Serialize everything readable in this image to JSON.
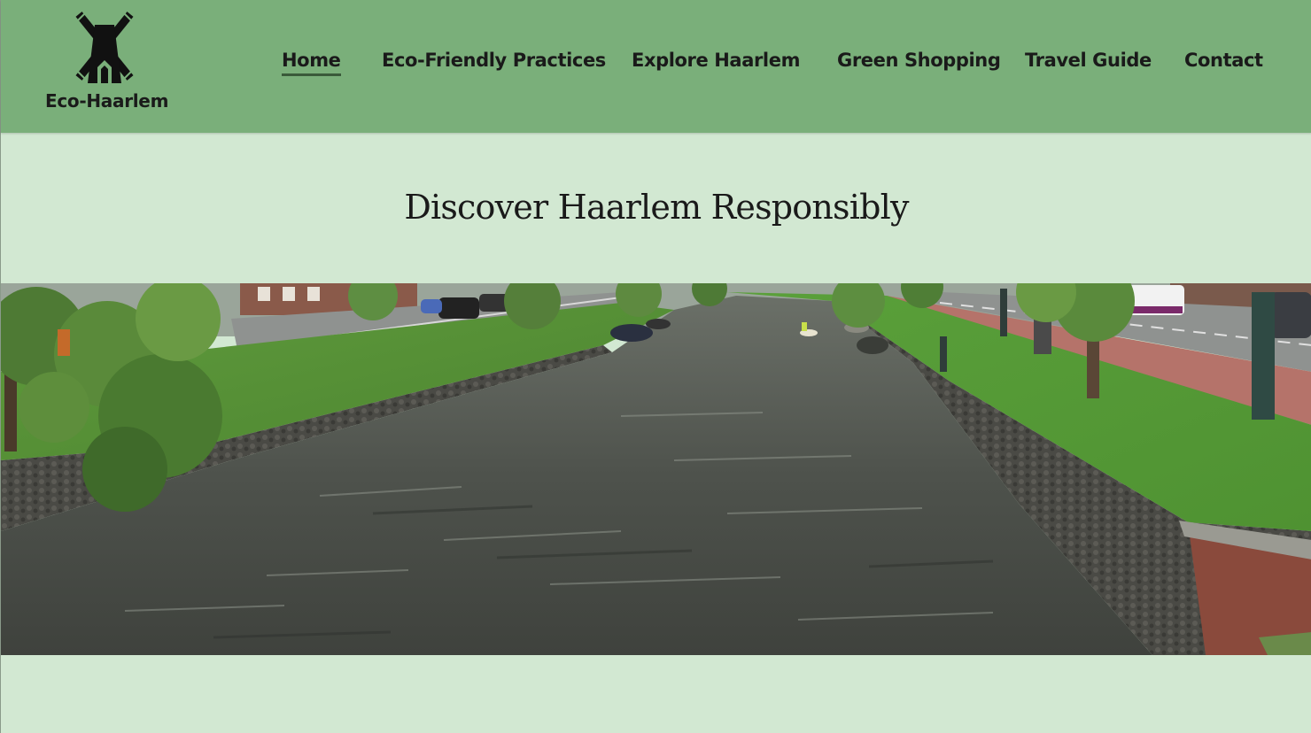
{
  "brand": {
    "name": "Eco-Haarlem",
    "logo_icon": "windmill-icon"
  },
  "nav": {
    "items": [
      {
        "label": "Home",
        "active": true
      },
      {
        "label": "Eco-Friendly Practices",
        "active": false
      },
      {
        "label": "Explore Haarlem",
        "active": false
      },
      {
        "label": "Green Shopping",
        "active": false
      },
      {
        "label": "Travel Guide",
        "active": false
      },
      {
        "label": "Contact",
        "active": false
      }
    ]
  },
  "hero": {
    "title": "Discover Haarlem Responsibly"
  },
  "colors": {
    "header_bg": "#7aaf7a",
    "page_bg": "#d2e8d2",
    "text": "#1a1a1a"
  }
}
